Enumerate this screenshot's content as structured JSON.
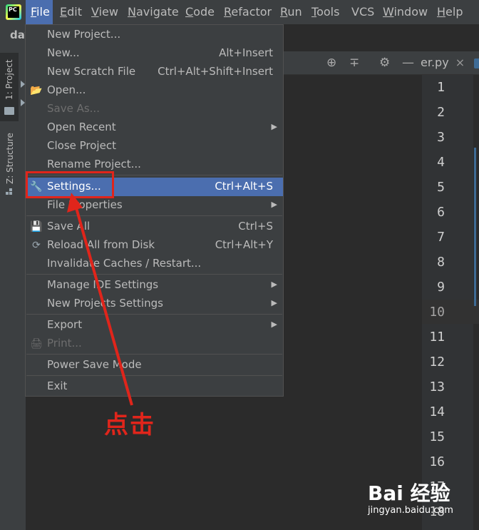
{
  "menubar": {
    "app_icon_text": "PC",
    "items": [
      {
        "label": "File",
        "ul": "F",
        "rest": "ile"
      },
      {
        "label": "Edit",
        "ul": "E",
        "rest": "dit"
      },
      {
        "label": "View",
        "ul": "V",
        "rest": "iew"
      },
      {
        "label": "Navigate",
        "ul": "N",
        "rest": "avigate"
      },
      {
        "label": "Code",
        "ul": "C",
        "rest": "ode"
      },
      {
        "label": "Refactor",
        "ul": "R",
        "rest": "efactor"
      },
      {
        "label": "Run",
        "ul": "R",
        "rest": "un"
      },
      {
        "label": "Tools",
        "ul": "T",
        "rest": "ools"
      },
      {
        "label": "VCS",
        "ul": "",
        "rest": "VCS"
      },
      {
        "label": "Window",
        "ul": "W",
        "rest": "indow"
      },
      {
        "label": "Help",
        "ul": "H",
        "rest": "elp"
      }
    ]
  },
  "sidebar": {
    "project_tab": "1: Project",
    "structure_tab": "Z: Structure"
  },
  "project_header": "day",
  "tabbar": {
    "file_tab": "er.py",
    "close_symbol": "×"
  },
  "file_menu": {
    "items": [
      {
        "label": "New Project...",
        "shortcut": ""
      },
      {
        "label": "New...",
        "shortcut": "Alt+Insert"
      },
      {
        "label": "New Scratch File",
        "shortcut": "Ctrl+Alt+Shift+Insert"
      },
      {
        "label": "Open...",
        "shortcut": ""
      },
      {
        "label": "Save As...",
        "shortcut": ""
      },
      {
        "label": "Open Recent",
        "shortcut": ""
      },
      {
        "label": "Close Project",
        "shortcut": ""
      },
      {
        "label": "Rename Project...",
        "shortcut": ""
      },
      {
        "label": "Settings...",
        "shortcut": "Ctrl+Alt+S"
      },
      {
        "label": "File Properties",
        "shortcut": ""
      },
      {
        "label": "Save All",
        "shortcut": "Ctrl+S"
      },
      {
        "label": "Reload All from Disk",
        "shortcut": "Ctrl+Alt+Y"
      },
      {
        "label": "Invalidate Caches / Restart...",
        "shortcut": ""
      },
      {
        "label": "Manage IDE Settings",
        "shortcut": ""
      },
      {
        "label": "New Projects Settings",
        "shortcut": ""
      },
      {
        "label": "Export",
        "shortcut": ""
      },
      {
        "label": "Print...",
        "shortcut": ""
      },
      {
        "label": "Power Save Mode",
        "shortcut": ""
      },
      {
        "label": "Exit",
        "shortcut": ""
      }
    ],
    "selected": "Settings..."
  },
  "line_numbers": [
    "1",
    "2",
    "3",
    "4",
    "5",
    "6",
    "7",
    "8",
    "9",
    "10",
    "11",
    "12",
    "13",
    "14",
    "15",
    "16",
    "17",
    "18"
  ],
  "current_line": "10",
  "annotation": {
    "label": "点击",
    "color": "#e0251b"
  },
  "watermark": {
    "brand": "Bai 经验",
    "site": "jingyan.baidu.com"
  },
  "colors": {
    "menu_bg": "#3c3f41",
    "selection": "#4b6eaf",
    "editor_bg": "#2b2b2b"
  }
}
